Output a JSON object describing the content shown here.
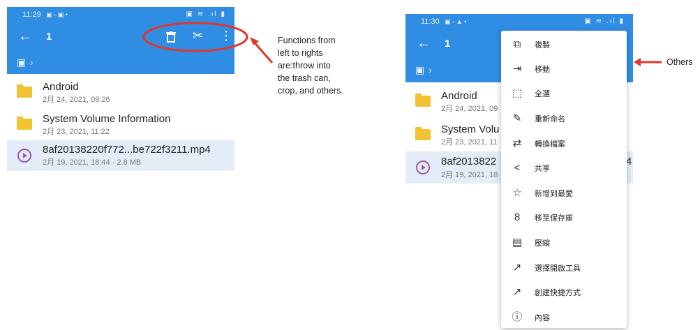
{
  "left_screen": {
    "status": {
      "time": "11:29",
      "icons": "▣ ◦ ▣ •",
      "right_icons": "▣ ≋ .ıl ▮"
    },
    "appbar": {
      "back": "←",
      "title": "1",
      "trash": "🗑",
      "cut": "✂",
      "more": "⋮"
    },
    "path": {
      "usb": "▣",
      "chevron": "›"
    },
    "files": [
      {
        "name": "Android",
        "meta": "2月 24, 2021, 09:26",
        "type": "folder"
      },
      {
        "name": "System Volume Information",
        "meta": "2月 23, 2021, 11:22",
        "type": "folder"
      },
      {
        "name": "8af20138220f772...be722f3211.mp4",
        "meta": "2月 19, 2021, 18:44 · 2.8 MB",
        "type": "video"
      }
    ]
  },
  "annotation_left": {
    "lines": [
      "Functions from",
      "left to rights",
      "are:throw into",
      "the trash can,",
      "crop, and others."
    ]
  },
  "right_screen": {
    "status": {
      "time": "11:30",
      "icons": "▣ ◦ ▲ •",
      "right_icons": "▣ ≋ .ıl ▮"
    },
    "appbar": {
      "back": "←",
      "title": "1"
    },
    "path": {
      "usb": "▣",
      "chevron": "›"
    },
    "files": [
      {
        "name": "Android",
        "meta": "2月 24, 2021, 09"
      },
      {
        "name": "System Volu",
        "meta": "2月 23, 2021, 11"
      },
      {
        "name": "8af2013822",
        "meta": "2月 19, 2021, 18",
        "tail": "4"
      }
    ]
  },
  "menu": {
    "items": [
      {
        "label": "複製",
        "icon": "copy-icon",
        "glyph": "⧉"
      },
      {
        "label": "移動",
        "icon": "move-icon",
        "glyph": "⇥"
      },
      {
        "label": "全選",
        "icon": "select-all-icon",
        "glyph": "⬚"
      },
      {
        "label": "重新命名",
        "icon": "rename-icon",
        "glyph": "✎"
      },
      {
        "label": "轉換檔案",
        "icon": "convert-icon",
        "glyph": "⇄"
      },
      {
        "label": "共享",
        "icon": "share-icon",
        "glyph": "<"
      },
      {
        "label": "新增到最愛",
        "icon": "star-icon",
        "glyph": "☆"
      },
      {
        "label": "移至保存庫",
        "icon": "vault-icon",
        "glyph": "8"
      },
      {
        "label": "壓縮",
        "icon": "compress-icon",
        "glyph": "▤"
      },
      {
        "label": "選擇開啟工具",
        "icon": "open-with-icon",
        "glyph": "↗"
      },
      {
        "label": "創建快捷方式",
        "icon": "shortcut-icon",
        "glyph": "↗"
      },
      {
        "label": "內容",
        "icon": "info-icon",
        "glyph": "ⓘ"
      }
    ]
  },
  "annotation_right": {
    "label": "Others"
  },
  "colors": {
    "primary": "#2f8de4",
    "highlight": "#e0362c",
    "folder": "#f2c232",
    "video": "#9a5bb0"
  }
}
